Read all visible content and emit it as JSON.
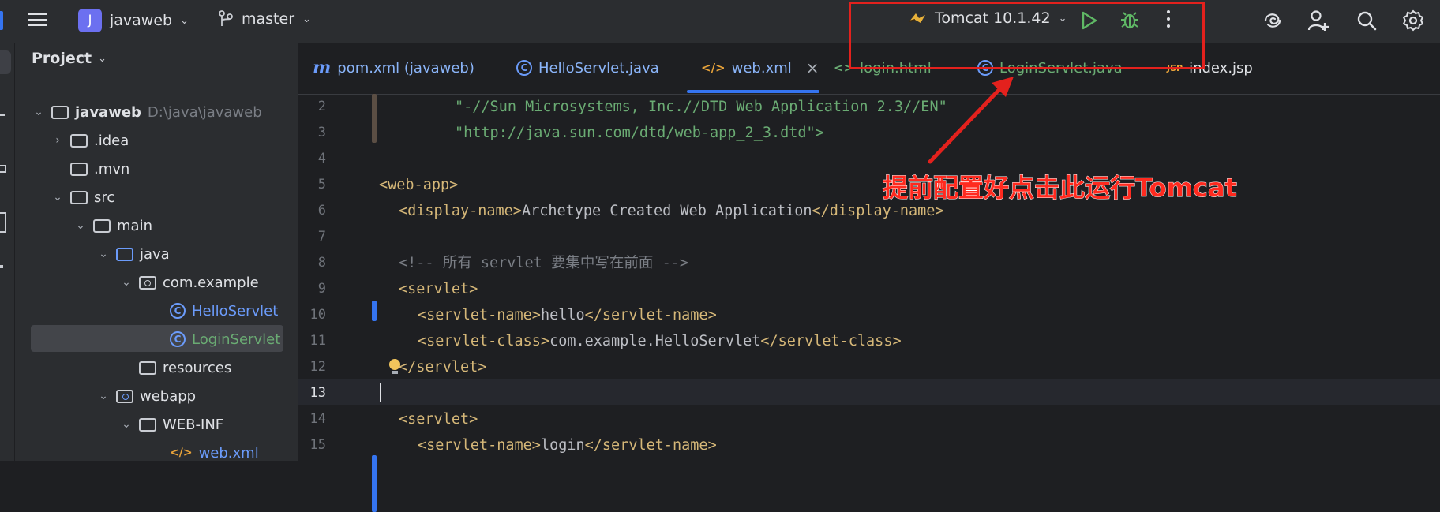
{
  "toolbar": {
    "project_initial": "J",
    "project_name": "javaweb",
    "branch": "master",
    "run_config": "Tomcat 10.1.42"
  },
  "tabs": [
    {
      "icon": "m",
      "label": "pom.xml (javaweb)"
    },
    {
      "icon": "C",
      "label": "HelloServlet.java"
    },
    {
      "icon": "</>",
      "label": "web.xml",
      "close": "×"
    },
    {
      "icon": "<>",
      "label": "login.html"
    },
    {
      "icon": "C",
      "label": "LoginServlet.java"
    },
    {
      "icon": "JSP",
      "label": "index.jsp"
    }
  ],
  "project_panel": {
    "title": "Project",
    "tree": [
      {
        "label": "javaweb",
        "path": "D:\\java\\javaweb"
      },
      {
        "label": ".idea"
      },
      {
        "label": ".mvn"
      },
      {
        "label": "src"
      },
      {
        "label": "main"
      },
      {
        "label": "java"
      },
      {
        "label": "com.example"
      },
      {
        "label": "HelloServlet"
      },
      {
        "label": "LoginServlet"
      },
      {
        "label": "resources"
      },
      {
        "label": "webapp"
      },
      {
        "label": "WEB-INF"
      },
      {
        "label": "web.xml"
      }
    ]
  },
  "editor": {
    "line_numbers": [
      "2",
      "3",
      "4",
      "5",
      "6",
      "7",
      "8",
      "9",
      "10",
      "11",
      "12",
      "13",
      "14",
      "15"
    ],
    "lines": {
      "l2": "\"-//Sun Microsystems, Inc.//DTD Web Application 2.3//EN\"",
      "l3": "\"http://java.sun.com/dtd/web-app_2_3.dtd\">",
      "l5": "<web-app>",
      "l6_open": "<display-name>",
      "l6_text": "Archetype Created Web Application",
      "l6_close": "</display-name>",
      "l8": "<!-- 所有 servlet 要集中写在前面 -->",
      "l9": "<servlet>",
      "l10_open": "<servlet-name>",
      "l10_text": "hello",
      "l10_close": "</servlet-name>",
      "l11_open": "<servlet-class>",
      "l11_text": "com.example.HelloServlet",
      "l11_close": "</servlet-class>",
      "l12": "</servlet>",
      "l14": "<servlet>",
      "l15_open": "<servlet-name>",
      "l15_text": "login",
      "l15_close": "</servlet-name>"
    }
  },
  "annotation": {
    "text": "提前配置好点击此运行Tomcat",
    "color": "#ff2a1f"
  },
  "colors": {
    "accent": "#3574f0",
    "xml_tag": "#d5b778",
    "string": "#6aab73",
    "comment": "#7a7e85",
    "run_green": "#5fb865"
  }
}
